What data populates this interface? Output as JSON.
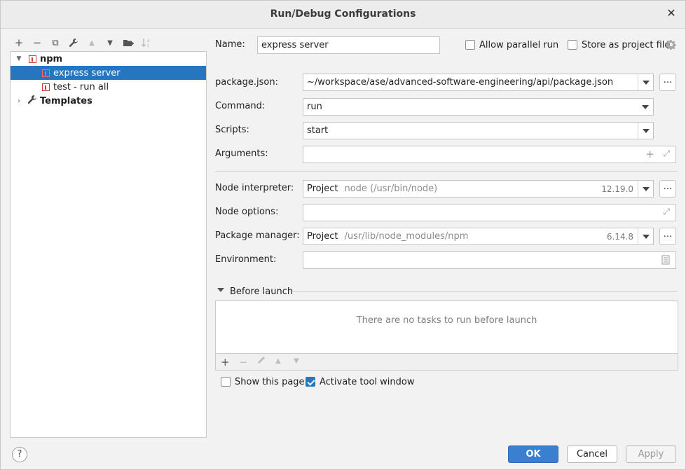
{
  "window": {
    "title": "Run/Debug Configurations"
  },
  "toolbar": {
    "add": "+",
    "remove": "−",
    "copy": "⧉",
    "edit": "🔧",
    "up": "▲",
    "down": "▼",
    "folder": "📁",
    "sort": "↓ᵃᶻ"
  },
  "tree": {
    "group_label": "npm",
    "items": [
      {
        "label": "express server"
      },
      {
        "label": "test - run all"
      }
    ],
    "templates_label": "Templates"
  },
  "form": {
    "name_label": "Name:",
    "name_value": "express server",
    "allow_parallel_label": "Allow parallel run",
    "store_label": "Store as project file",
    "package_json_label": "package.json:",
    "package_json_value": "~/workspace/ase/advanced-software-engineering/api/package.json",
    "command_label": "Command:",
    "command_value": "run",
    "scripts_label": "Scripts:",
    "scripts_value": "start",
    "arguments_label": "Arguments:",
    "arguments_value": "",
    "node_interpreter_label": "Node interpreter:",
    "node_interpreter_project": "Project",
    "node_interpreter_path": "node (/usr/bin/node)",
    "node_interpreter_version": "12.19.0",
    "node_options_label": "Node options:",
    "node_options_value": "",
    "package_manager_label": "Package manager:",
    "package_manager_project": "Project",
    "package_manager_path": "/usr/lib/node_modules/npm",
    "package_manager_version": "6.14.8",
    "environment_label": "Environment:",
    "environment_value": "",
    "browse_label": "...",
    "before_launch_label": "Before launch",
    "before_launch_empty": "There are no tasks to run before launch",
    "show_page_label": "Show this page",
    "activate_tool_label": "Activate tool window"
  },
  "checkboxes": {
    "allow_parallel": false,
    "store_project": false,
    "show_page": false,
    "activate_tool": true
  },
  "buttons": {
    "ok": "OK",
    "cancel": "Cancel",
    "apply": "Apply",
    "help": "?"
  },
  "colors": {
    "accent": "#2675bf",
    "npm_red": "#cb3837"
  }
}
